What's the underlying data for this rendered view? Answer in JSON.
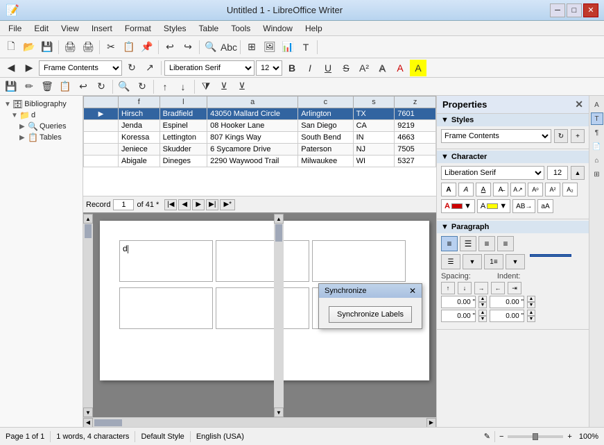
{
  "window": {
    "title": "Untitled 1 - LibreOffice Writer",
    "min_label": "─",
    "max_label": "□",
    "close_label": "✕"
  },
  "menu": {
    "items": [
      "File",
      "Edit",
      "View",
      "Insert",
      "Format",
      "Styles",
      "Table",
      "Tools",
      "Window",
      "Help"
    ]
  },
  "toolbar_main": {
    "frame_contents": "Frame Contents"
  },
  "toolbar_format": {
    "font_name": "Liberation Serif",
    "font_size": "12"
  },
  "navigator": {
    "root_label": "Bibliography",
    "root_child": "d",
    "queries_label": "Queries",
    "tables_label": "Tables"
  },
  "table": {
    "columns": [
      "f",
      "l",
      "a",
      "c",
      "s",
      "z"
    ],
    "rows": [
      {
        "f": "Hirsch",
        "l": "Bradfield",
        "a": "43050 Mallard Circle",
        "c": "Arlington",
        "s": "TX",
        "z": "7601",
        "selected": true
      },
      {
        "f": "Jenda",
        "l": "Espinel",
        "a": "08 Hooker Lane",
        "c": "San Diego",
        "s": "CA",
        "z": "9219",
        "selected": false
      },
      {
        "f": "Koressa",
        "l": "Lettington",
        "a": "807 Kings Way",
        "c": "South Bend",
        "s": "IN",
        "z": "4663",
        "selected": false
      },
      {
        "f": "Jeniece",
        "l": "Skudder",
        "a": "6 Sycamore Drive",
        "c": "Paterson",
        "s": "NJ",
        "z": "7505",
        "selected": false
      },
      {
        "f": "Abigale",
        "l": "Dineges",
        "a": "2290 Waywood Trail",
        "c": "Milwaukee",
        "s": "WI",
        "z": "5327",
        "selected": false
      }
    ]
  },
  "record_nav": {
    "record_label": "Record",
    "current": "1",
    "of_label": "of 41 *"
  },
  "doc": {
    "cursor_text": "d"
  },
  "sync_dialog": {
    "title": "Synchronize",
    "close_label": "✕",
    "button_label": "Synchronize Labels"
  },
  "properties": {
    "title": "Properties",
    "close_label": "✕",
    "styles_section": "Styles",
    "styles_value": "Frame Contents",
    "char_section": "Character",
    "font_name": "Liberation Serif",
    "font_size": "12",
    "para_section": "Paragraph",
    "spacing_label": "Spacing:",
    "indent_label": "Indent:",
    "spacing_above": "0.00 \"",
    "spacing_below": "0.00 \"",
    "indent_before": "0.00 \"",
    "indent_after": "0.00 \""
  },
  "status_bar": {
    "page_info": "Page 1 of 1",
    "words": "1 words, 4 characters",
    "style": "Default Style",
    "language": "English (USA)",
    "zoom": "100%"
  }
}
